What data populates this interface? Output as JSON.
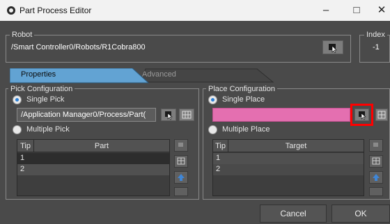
{
  "window": {
    "title": "Part Process Editor",
    "minimize_glyph": "–",
    "maximize_glyph": "□",
    "close_glyph": "✕"
  },
  "robot": {
    "legend": "Robot",
    "path": "/Smart Controller0/Robots/R1Cobra800"
  },
  "index": {
    "legend": "Index",
    "value": "-1"
  },
  "tabs": [
    {
      "label": "Properties",
      "active": true
    },
    {
      "label": "Advanced",
      "active": false
    }
  ],
  "pick": {
    "legend": "Pick Configuration",
    "single_label": "Single Pick",
    "path": "/Application Manager0/Process/Part(",
    "multiple_label": "Multiple Pick",
    "columns": [
      "Tip",
      "Part"
    ],
    "rows": [
      "1",
      "2"
    ]
  },
  "place": {
    "legend": "Place Configuration",
    "single_label": "Single Place",
    "path": "",
    "multiple_label": "Multiple Place",
    "columns": [
      "Tip",
      "Target"
    ],
    "rows": [
      "1",
      "2"
    ]
  },
  "footer": {
    "cancel_label": "Cancel",
    "ok_label": "OK"
  },
  "colors": {
    "tab_active": "#62a3d3",
    "place_field": "#e46fb0",
    "highlight": "#ff0000"
  }
}
